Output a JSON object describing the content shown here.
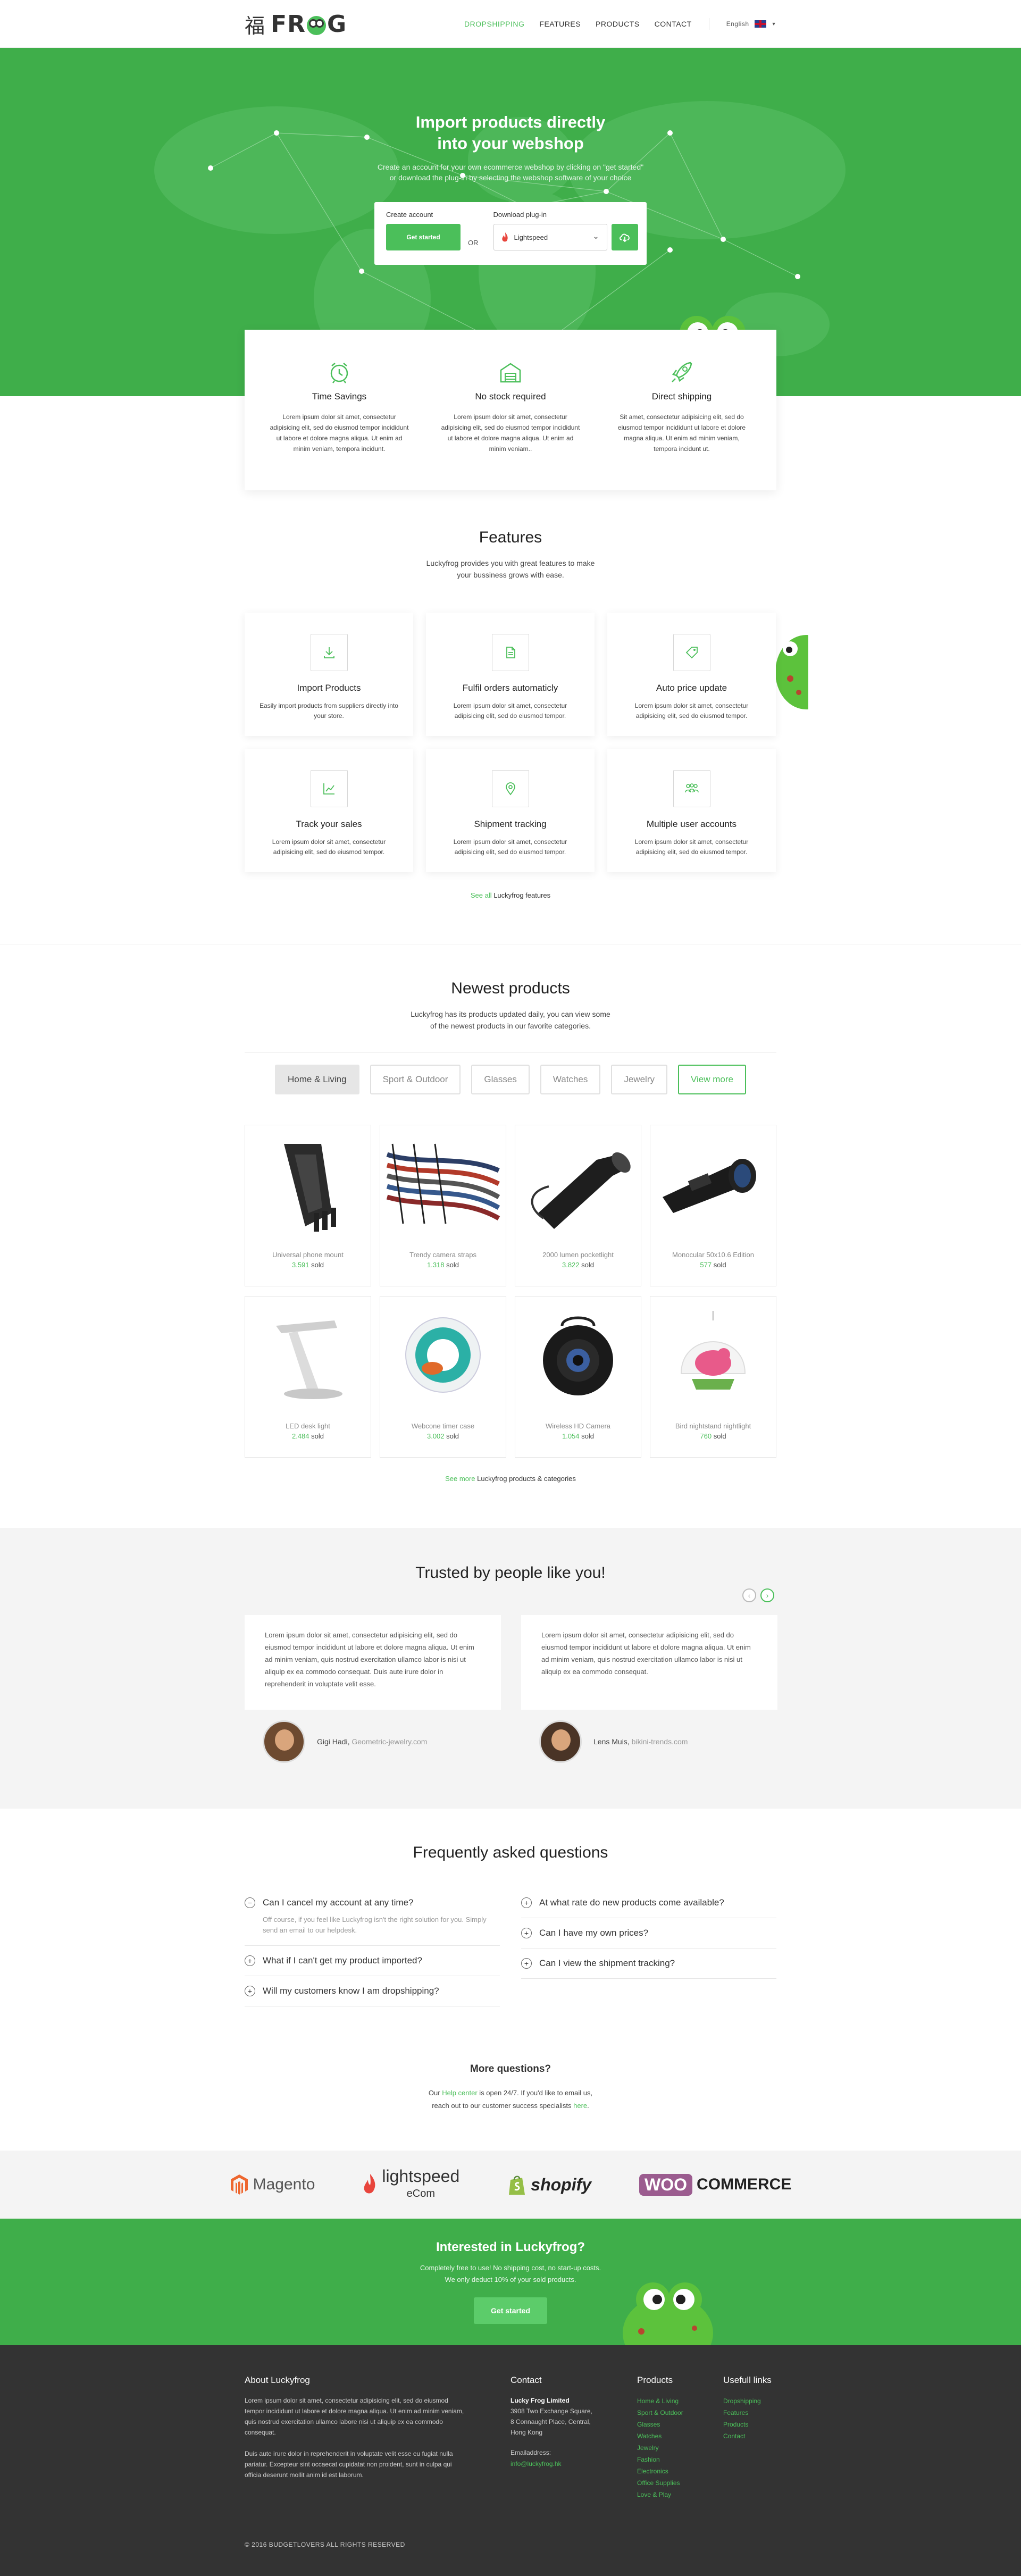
{
  "header": {
    "logo_char": "福",
    "logo_text_a": "FR",
    "logo_text_b": "G",
    "nav": [
      "DROPSHIPPING",
      "FEATURES",
      "PRODUCTS",
      "CONTACT"
    ],
    "language": "English"
  },
  "hero": {
    "title_line1": "Import products directly",
    "title_line2": "into your webshop",
    "subtitle_line1": "Create an account for your own ecommerce webshop by clicking on \"get started\"",
    "subtitle_line2": "or download the plug-in by selecting the webshop software of your choice",
    "create_label": "Create account",
    "get_started": "Get started",
    "or": "OR",
    "download_label": "Download plug-in",
    "platform": "Lightspeed"
  },
  "benefits": [
    {
      "title": "Time Savings",
      "icon": "alarm-clock-icon",
      "text": "Lorem ipsum dolor sit amet, consectetur adipisicing elit, sed do eiusmod tempor incididunt ut labore et dolore magna aliqua. Ut enim ad minim veniam, tempora incidunt."
    },
    {
      "title": "No stock required",
      "icon": "warehouse-icon",
      "text": "Lorem ipsum dolor sit amet, consectetur adipisicing elit, sed do eiusmod tempor incididunt ut labore et dolore magna aliqua. Ut enim ad minim veniam.."
    },
    {
      "title": "Direct shipping",
      "icon": "rocket-icon",
      "text": "Sit amet, consectetur adipisicing elit, sed do eiusmod tempor incididunt ut labore et dolore magna aliqua. Ut enim ad minim veniam, tempora incidunt ut."
    }
  ],
  "features": {
    "title": "Features",
    "intro": "Luckyfrog provides you with great features to make your bussiness grows with ease.",
    "items": [
      {
        "title": "Import Products",
        "icon": "download-icon",
        "text": "Easily import products from suppliers directly into your store."
      },
      {
        "title": "Fulfil orders automaticly",
        "icon": "document-icon",
        "text": "Lorem ipsum dolor sit amet, consectetur adipisicing elit, sed do eiusmod tempor."
      },
      {
        "title": "Auto price update",
        "icon": "price-tag-icon",
        "text": "Lorem ipsum dolor sit amet, consectetur adipisicing elit, sed do eiusmod tempor."
      },
      {
        "title": "Track your sales",
        "icon": "chart-icon",
        "text": "Lorem ipsum dolor sit amet, consectetur adipisicing elit, sed do eiusmod tempor."
      },
      {
        "title": "Shipment tracking",
        "icon": "location-pin-icon",
        "text": "Lorem ipsum dolor sit amet, consectetur adipisicing elit, sed do eiusmod tempor."
      },
      {
        "title": "Multiple user accounts",
        "icon": "users-icon",
        "text": "Lorem ipsum dolor sit amet, consectetur adipisicing elit, sed do eiusmod tempor."
      }
    ],
    "see_all_link": "See all",
    "see_all_rest": " Luckyfrog features"
  },
  "newest": {
    "title": "Newest products",
    "intro": "Luckyfrog has its products updated daily, you can view some of the newest products in our favorite categories.",
    "tabs": [
      "Home & Living",
      "Sport & Outdoor",
      "Glasses",
      "Watches",
      "Jewelry"
    ],
    "view_more": "View more",
    "sold_word": "sold",
    "products": [
      {
        "name": "Universal phone mount",
        "sold": "3.591"
      },
      {
        "name": "Trendy camera straps",
        "sold": "1.318"
      },
      {
        "name": "2000 lumen pocketlight",
        "sold": "3.822"
      },
      {
        "name": "Monocular 50x10.6 Edition",
        "sold": "577"
      },
      {
        "name": "LED desk light",
        "sold": "2.484"
      },
      {
        "name": "Webcone timer case",
        "sold": "3.002"
      },
      {
        "name": "Wireless HD Camera",
        "sold": "1.054"
      },
      {
        "name": "Bird nightstand nightlight",
        "sold": "760"
      }
    ],
    "see_more_link": "See more",
    "see_more_rest": " Luckyfrog products & categories"
  },
  "testimonials": {
    "title": "Trusted by people like you!",
    "items": [
      {
        "text": "Lorem ipsum dolor sit amet, consectetur adipisicing elit, sed do eiusmod tempor incididunt ut labore et dolore magna aliqua. Ut enim ad minim veniam, quis nostrud exercitation ullamco labor is nisi ut aliquip ex ea commodo consequat. Duis aute irure dolor in reprehenderit in voluptate velit esse.",
        "name": "Gigi Hadi,",
        "site": "Geometric-jewelry.com"
      },
      {
        "text": "Lorem ipsum dolor sit amet, consectetur adipisicing elit, sed do eiusmod tempor incididunt ut labore et dolore magna aliqua. Ut enim ad minim veniam, quis nostrud exercitation ullamco labor is nisi ut aliquip ex ea commodo consequat.",
        "name": "Lens Muis,",
        "site": "bikini-trends.com"
      }
    ]
  },
  "faq": {
    "title": "Frequently asked questions",
    "left": [
      {
        "q": "Can I cancel my account at any time?",
        "a": "Off course, if you feel like Luckyfrog isn't the right solution for you. Simply send an email to our helpdesk.",
        "open": true
      },
      {
        "q": "What if I can't get my product imported?",
        "a": "",
        "open": false
      },
      {
        "q": "Will my customers know I am dropshipping?",
        "a": "",
        "open": false
      }
    ],
    "right": [
      {
        "q": "At what rate do new products come available?"
      },
      {
        "q": "Can I have my own prices?"
      },
      {
        "q": "Can I view the shipment tracking?"
      }
    ],
    "more_title": "More questions?",
    "more_p1_a": "Our ",
    "more_p1_link": "Help center",
    "more_p1_b": " is open 24/7. If you'd like to email us,",
    "more_p2_a": "reach out to our customer success specialists ",
    "more_p2_link": "here",
    "more_p2_b": "."
  },
  "partners": [
    "Magento",
    "lightspeed",
    "eCom",
    "shopify",
    "WOO",
    "COMMERCE"
  ],
  "cta": {
    "title": "Interested in Luckyfrog?",
    "line1": "Completely free to use! No shipping cost, no start-up costs.",
    "line2": "We only deduct 10% of your sold products.",
    "button": "Get started"
  },
  "footer": {
    "about_title": "About Luckyfrog",
    "about_p1": "Lorem ipsum dolor sit amet, consectetur adipisicing elit, sed do eiusmod tempor incididunt ut labore et dolore magna aliqua. Ut enim ad minim veniam, quis nostrud exercitation ullamco labore nisi ut aliquip ex ea commodo consequat.",
    "about_p2": "Duis aute irure dolor in reprehenderit in voluptate velit esse eu fugiat nulla pariatur. Excepteur sint occaecat cupidatat non proident, sunt in culpa qui officia deserunt mollit anim id est laborum.",
    "contact_title": "Contact",
    "company": "Lucky Frog Limited",
    "address1": "3908 Two Exchange Square,",
    "address2": "8 Connaught Place, Central,",
    "address3": "Hong Kong",
    "email_label": "Emailaddress:",
    "email": "info@luckyfrog.hk",
    "products_title": "Products",
    "product_links": [
      "Home & Living",
      "Sport & Outdoor",
      "Glasses",
      "Watches",
      "Jewelry",
      "Fashion",
      "Electronics",
      "Office Supplies",
      "Love & Play"
    ],
    "useful_title": "Usefull links",
    "useful_links": [
      "Dropshipping",
      "Features",
      "Products",
      "Contact"
    ],
    "copyright": "© 2016 BUDGETLOVERS ALL RIGHTS RESERVED"
  },
  "colors": {
    "brand_green": "#4bbf5a",
    "hero_green": "#3fae4a",
    "footer_dark": "#333333"
  }
}
